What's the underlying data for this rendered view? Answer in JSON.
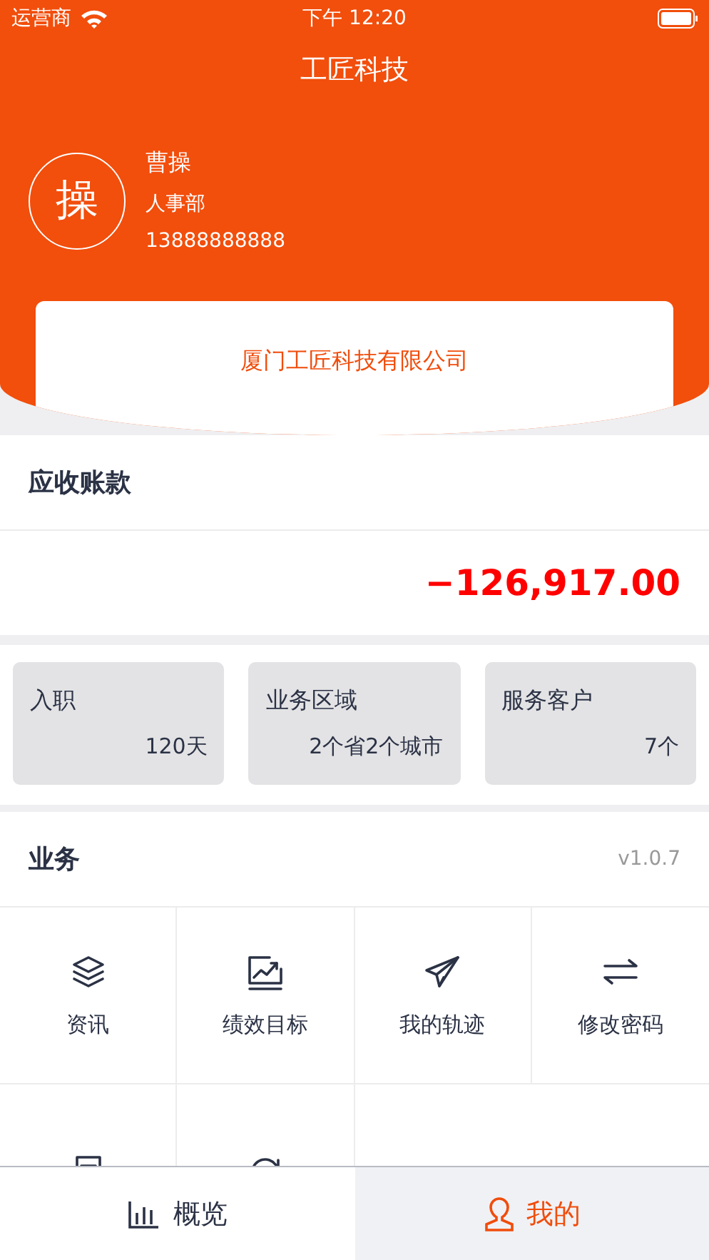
{
  "status_bar": {
    "carrier": "运营商",
    "time": "下午 12:20"
  },
  "header": {
    "title": "工匠科技"
  },
  "profile": {
    "avatar_char": "操",
    "name": "曹操",
    "department": "人事部",
    "phone": "13888888888"
  },
  "company": "厦门工匠科技有限公司",
  "receivables": {
    "title": "应收账款",
    "amount": "−126,917.00"
  },
  "stats": [
    {
      "label": "入职",
      "value": "120天"
    },
    {
      "label": "业务区域",
      "value": "2个省2个城市"
    },
    {
      "label": "服务客户",
      "value": "7个"
    }
  ],
  "business": {
    "title": "业务",
    "version": "v1.0.7",
    "items": [
      {
        "kind": "layers",
        "label": "资讯"
      },
      {
        "kind": "chart",
        "label": "绩效目标"
      },
      {
        "kind": "plane",
        "label": "我的轨迹"
      },
      {
        "kind": "swap",
        "label": "修改密码"
      },
      {
        "kind": "doc"
      },
      {
        "kind": "sync"
      }
    ]
  },
  "tabs": [
    {
      "kind": "overview",
      "label": "概览",
      "selected": false
    },
    {
      "kind": "me",
      "label": "我的",
      "selected": true
    }
  ]
}
